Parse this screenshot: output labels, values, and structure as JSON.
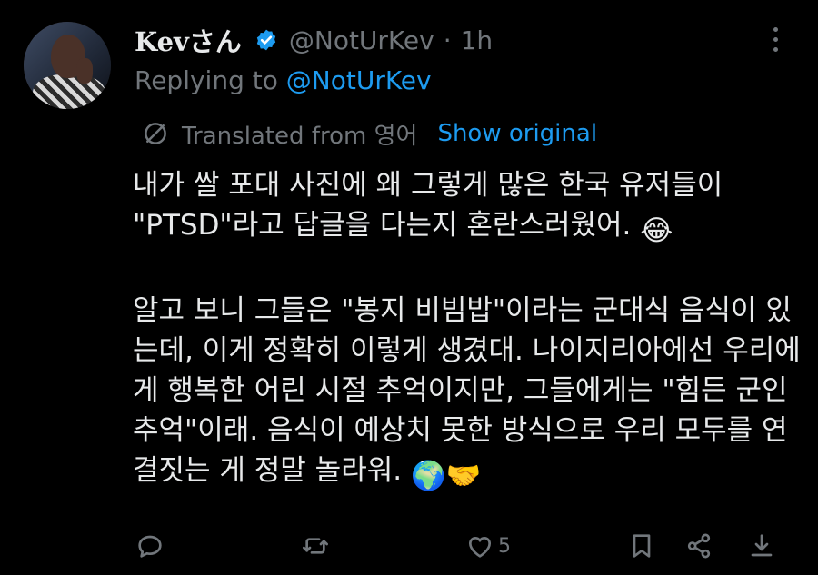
{
  "tweet": {
    "display_name": "Kevさん",
    "handle": "@NotUrKev",
    "separator": "·",
    "time": "1h",
    "reply_prefix": "Replying to",
    "reply_to": "@NotUrKev",
    "translated_label": "Translated from 영어",
    "show_original": "Show original",
    "paragraph_1": "내가 쌀 포대 사진에 왜 그렇게 많은 한국 유저들이 \"PTSD\"라고 답글을 다는지 혼란스러웠어.",
    "paragraph_2": "알고 보니 그들은 \"봉지 비빔밥\"이라는 군대식 음식이 있는데, 이게 정확히 이렇게 생겼대. 나이지리아에선 우리에게 행복한 어린 시절 추억이지만, 그들에게는 \"힘든 군인 추억\"이래. 음식이 예상치 못한 방식으로 우리 모두를 연결짓는 게 정말 놀라워.",
    "emoji_1": "😂",
    "emoji_2": "🌍🤝"
  },
  "actions": {
    "like_count": "5"
  },
  "icons": [
    "verified-badge-icon",
    "more-options-icon",
    "translate-globe-icon",
    "reply-icon",
    "retweet-icon",
    "like-icon",
    "bookmark-icon",
    "share-icon",
    "download-icon"
  ],
  "colors": {
    "background": "#000000",
    "text": "#e7e9ea",
    "muted": "#71767b",
    "accent": "#1d9bf0"
  }
}
